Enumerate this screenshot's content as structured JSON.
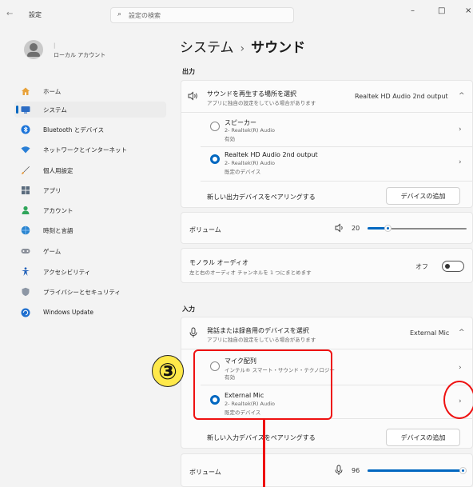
{
  "window": {
    "back_glyph": "←",
    "title": "設定",
    "minimize": "–",
    "maximize": "□",
    "close": "×"
  },
  "search": {
    "placeholder": "設定の検索",
    "icon": "search-icon"
  },
  "profile": {
    "separator": "|",
    "name": "ローカル アカウント"
  },
  "sidebar": {
    "items": [
      {
        "label": "ホーム",
        "icon": "home-icon",
        "active": false
      },
      {
        "label": "システム",
        "icon": "display-icon",
        "active": true
      },
      {
        "label": "Bluetooth とデバイス",
        "icon": "bluetooth-icon",
        "active": false
      },
      {
        "label": "ネットワークとインターネット",
        "icon": "wifi-icon",
        "active": false
      },
      {
        "label": "個人用設定",
        "icon": "brush-icon",
        "active": false
      },
      {
        "label": "アプリ",
        "icon": "apps-icon",
        "active": false
      },
      {
        "label": "アカウント",
        "icon": "account-icon",
        "active": false
      },
      {
        "label": "時刻と言語",
        "icon": "globe-clock-icon",
        "active": false
      },
      {
        "label": "ゲーム",
        "icon": "gamepad-icon",
        "active": false
      },
      {
        "label": "アクセシビリティ",
        "icon": "accessibility-icon",
        "active": false
      },
      {
        "label": "プライバシーとセキュリティ",
        "icon": "shield-icon",
        "active": false
      },
      {
        "label": "Windows Update",
        "icon": "update-icon",
        "active": false
      }
    ]
  },
  "heading": {
    "parent": "システム",
    "separator": "›",
    "current": "サウンド"
  },
  "output": {
    "section_label": "出力",
    "select": {
      "title": "サウンドを再生する場所を選択",
      "sub": "アプリに独自の設定をしている場合があります",
      "value": "Realtek HD Audio 2nd output",
      "chevron": "^"
    },
    "devices": [
      {
        "name": "スピーカー",
        "line1": "2- Realtek(R) Audio",
        "line2": "有効",
        "selected": false
      },
      {
        "name": "Realtek HD Audio 2nd output",
        "line1": "2- Realtek(R) Audio",
        "line2": "既定のデバイス",
        "selected": true
      }
    ],
    "pair": {
      "label": "新しい出力デバイスをペアリングする",
      "button": "デバイスの追加"
    },
    "volume": {
      "label": "ボリューム",
      "value": "20",
      "fraction": 0.2,
      "icon": "speaker-icon"
    },
    "mono": {
      "title": "モノラル オーディオ",
      "sub": "左と右のオーディオ チャンネルを 1 つにまとめます",
      "state": "オフ"
    }
  },
  "input": {
    "section_label": "入力",
    "select": {
      "title": "発話または録音用のデバイスを選択",
      "sub": "アプリに独自の設定をしている場合があります",
      "value": "External Mic",
      "chevron": "^"
    },
    "devices": [
      {
        "name": "マイク配列",
        "line1": "インテル® スマート・サウンド・テクノロジー",
        "line2": "有効",
        "selected": false
      },
      {
        "name": "External Mic",
        "line1": "2- Realtek(R) Audio",
        "line2": "既定のデバイス",
        "selected": true
      }
    ],
    "pair": {
      "label": "新しい入力デバイスをペアリングする",
      "button": "デバイスの追加"
    },
    "volume": {
      "label": "ボリューム",
      "value": "96",
      "fraction": 0.96,
      "icon": "microphone-icon"
    }
  },
  "annotation": {
    "badge": "③",
    "color": "#ee1111"
  },
  "colors": {
    "accent": "#0067c0",
    "annotation_red": "#ee1111",
    "badge_yellow": "#ffe94a"
  }
}
